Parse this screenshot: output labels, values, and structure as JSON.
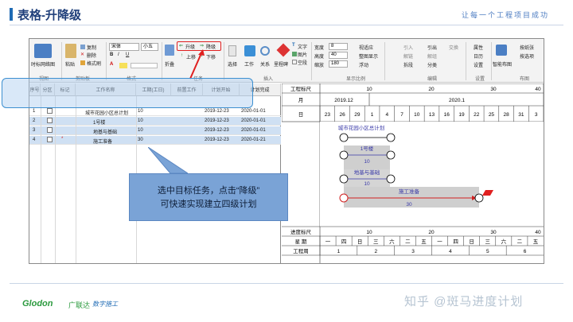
{
  "slide": {
    "title": "表格-升降级",
    "slogan": "让每一个工程项目成功",
    "callout_line1": "选中目标任务，点击“降级”",
    "callout_line2": "可快速实现建立四级计划",
    "brand_en": "Glodon",
    "brand_cn": "广联达",
    "brand_sub": "数字施工",
    "watermark": "知乎 @斑马进度计划"
  },
  "ribbon": {
    "view_btn": "时标网络图",
    "group_view": "视图",
    "paste": "粘贴",
    "copy": "复制",
    "delete": "删除",
    "format_brush": "格式刷",
    "group_clipboard": "剪贴板",
    "font_name": "宋体",
    "font_size": "小五",
    "bold": "B",
    "italic": "I",
    "underline": "U",
    "group_format": "格式",
    "fold": "折叠",
    "upgrade": "升级",
    "downgrade": "降级",
    "move_up": "上移",
    "move_down": "下移",
    "group_task": "任务",
    "select": "选择",
    "work": "工作",
    "relation": "关系",
    "milestone": "里程碑",
    "text": "文字",
    "image": "图片",
    "blank": "空段",
    "group_insert": "插入",
    "width_label": "宽度",
    "width_value": "8",
    "height_label": "高度",
    "height_value": "40",
    "zoom_label": "缩放",
    "zoom_value": "180",
    "fit_view": "视适应",
    "full_show": "整图显示",
    "float": "浮动",
    "group_display": "显示比例",
    "link": "引入",
    "unlink": "解链",
    "split": "拆段",
    "outgoing": "引出",
    "unlink2": "解组",
    "classify": "分类",
    "exchange": "交换",
    "group_edit": "编辑",
    "properties": "属性",
    "calendar": "日历",
    "settings": "设置",
    "group_settings": "设置",
    "smart_layout": "智能布图",
    "by_group": "按纸张",
    "by_selection": "按选项",
    "group_layout": "布图"
  },
  "table": {
    "columns": [
      "序号",
      "分区",
      "标记",
      "工作名称",
      "工期(工日)",
      "前置工作",
      "计划开始",
      "计划完成"
    ],
    "rows": [
      {
        "num": "1",
        "name": "城市花园小区总计划",
        "duration": "10",
        "pre": "",
        "start": "2019-12-23",
        "end": "2020-01-01",
        "selected": false
      },
      {
        "num": "2",
        "name": "1号楼",
        "duration": "10",
        "pre": "",
        "start": "2019-12-23",
        "end": "2020-01-01",
        "selected": true
      },
      {
        "num": "3",
        "name": "地基与基础",
        "duration": "10",
        "pre": "",
        "start": "2019-12-23",
        "end": "2020-01-01",
        "selected": true
      },
      {
        "num": "4",
        "name": "施工准备",
        "duration": "30",
        "pre": "",
        "start": "2019-12-23",
        "end": "2020-01-21",
        "selected": true
      }
    ]
  },
  "gantt": {
    "label_scale": "工程标尺",
    "label_month": "月",
    "label_day": "日",
    "scale_ticks": [
      "10",
      "20",
      "30",
      "40"
    ],
    "month_a": "2019.12",
    "month_b": "2020.1",
    "days": [
      "23",
      "26",
      "29",
      "1",
      "4",
      "7",
      "10",
      "13",
      "16",
      "19",
      "22",
      "25",
      "28",
      "31",
      "3"
    ],
    "task_total": "城市花园小区总计划",
    "task_bldg": "1号楼",
    "task_found": "地基与基础",
    "task_prep": "施工准备",
    "dur_10a": "10",
    "dur_10b": "10",
    "dur_30": "30",
    "label_progress": "进度标尺",
    "progress_ticks": [
      "10",
      "20",
      "30",
      "40"
    ],
    "label_week": "星 期",
    "weekdays": [
      "一",
      "四",
      "日",
      "三",
      "六",
      "二",
      "五",
      "一",
      "四",
      "日",
      "三",
      "六",
      "二",
      "五"
    ],
    "label_work_week": "工程周",
    "work_weeks": [
      "1",
      "2",
      "3",
      "4",
      "5",
      "6"
    ]
  }
}
